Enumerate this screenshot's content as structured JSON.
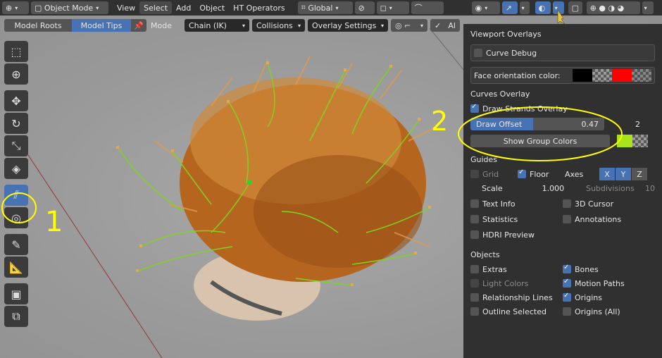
{
  "header": {
    "mode": "Object Mode",
    "menus": [
      "View",
      "Select",
      "Add",
      "Object",
      "HT Operators"
    ],
    "orientation": "Global"
  },
  "tool_header": {
    "tabs": [
      "Model Roots",
      "Model Tips"
    ],
    "mode_label": "Mode",
    "chain": "Chain (IK)",
    "collisions": "Collisions",
    "overlay_settings": "Overlay Settings",
    "cut_text": "Al"
  },
  "toolbar": {
    "icons": [
      "select-box-icon",
      "cursor-icon",
      "move-icon",
      "rotate-icon",
      "scale-icon",
      "transform-icon",
      "hair-brush-icon",
      "shrink-icon",
      "annotate-icon",
      "measure-icon",
      "add-cube-icon",
      "transform-cube-icon"
    ]
  },
  "panel": {
    "title": "Viewport Overlays",
    "curve_debug": "Curve Debug",
    "face_orientation_label": "Face orientation color:",
    "curves_overlay": "Curves Overlay",
    "draw_strands": "Draw Strands Overlay",
    "draw_offset_label": "Draw Offset",
    "draw_offset_value": "0.47",
    "draw_offset_fraction": 0.47,
    "side_value": "2",
    "show_group_colors": "Show Group Colors",
    "guides": "Guides",
    "grid": "Grid",
    "floor": "Floor",
    "axes": "Axes",
    "axis_x": "X",
    "axis_y": "Y",
    "axis_z": "Z",
    "scale_label": "Scale",
    "scale_value": "1.000",
    "subdivisions_label": "Subdivisions",
    "subdivisions_value": "10",
    "text_info": "Text Info",
    "cursor_3d": "3D Cursor",
    "statistics": "Statistics",
    "annotations": "Annotations",
    "hdri_preview": "HDRI Preview",
    "objects": "Objects",
    "extras": "Extras",
    "bones": "Bones",
    "light_colors": "Light Colors",
    "motion_paths": "Motion Paths",
    "relationship_lines": "Relationship Lines",
    "origins": "Origins",
    "outline_selected": "Outline Selected",
    "origins_all": "Origins (All)"
  },
  "annotations": {
    "one": "1",
    "two": "2"
  },
  "colors": {
    "accent": "#4772b3",
    "highlight": "#ffff00",
    "strands": "#7ed321",
    "hair": "#b8651e"
  }
}
